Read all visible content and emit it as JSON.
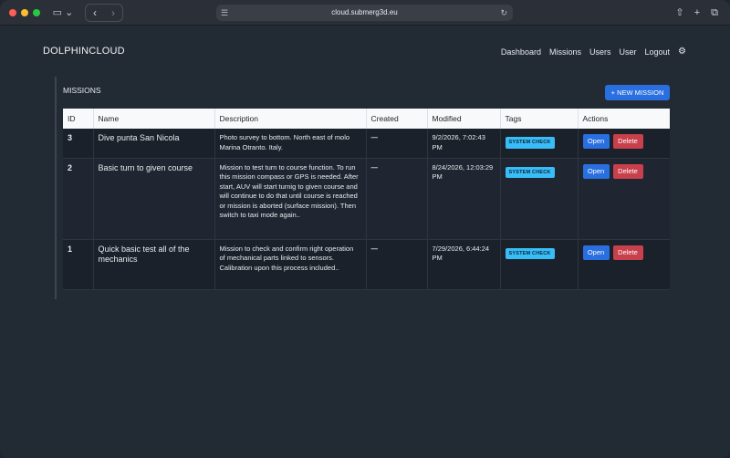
{
  "browser": {
    "url": "cloud.submerg3d.eu"
  },
  "app": {
    "brand": "DOLPHINCLOUD",
    "nav": [
      "Dashboard",
      "Missions",
      "Users",
      "User",
      "Logout"
    ]
  },
  "missions": {
    "title": "MISSIONS",
    "new_button": "+ NEW MISSION",
    "columns": [
      "ID",
      "Name",
      "Description",
      "Created",
      "Modified",
      "Tags",
      "Actions"
    ],
    "rows": [
      {
        "id": "3",
        "name": "Dive punta San Nicola",
        "description": "Photo survey to bottom. North east of molo Marina Otranto. Italy.",
        "created": "—",
        "modified": "9/2/2026, 7:02:43 PM",
        "tag": "SYSTEM CHECK",
        "open": "Open",
        "delete": "Delete"
      },
      {
        "id": "2",
        "name": "Basic turn to given course",
        "description": "Mission to test turn to course function. To run this mission compass or GPS is needed. After start, AUV will start turnig to given course and will continue to do that until course is reached or mission is aborted (surface mission). Then switch to taxi mode again..",
        "created": "—",
        "modified": "8/24/2026, 12:03:29 PM",
        "tag": "SYSTEM CHECK",
        "open": "Open",
        "delete": "Delete"
      },
      {
        "id": "1",
        "name": "Quick basic test all of the mechanics",
        "description": "Mission to check and confirm right operation of mechanical parts linked to sensors. Calibration upon this process included..",
        "created": "—",
        "modified": "7/29/2026, 6:44:24 PM",
        "tag": "SYSTEM CHECK",
        "open": "Open",
        "delete": "Delete"
      }
    ]
  },
  "colors": {
    "primary": "#2a6fe0",
    "danger": "#c8404b",
    "tag": "#38bdf8",
    "background": "#222a34"
  }
}
